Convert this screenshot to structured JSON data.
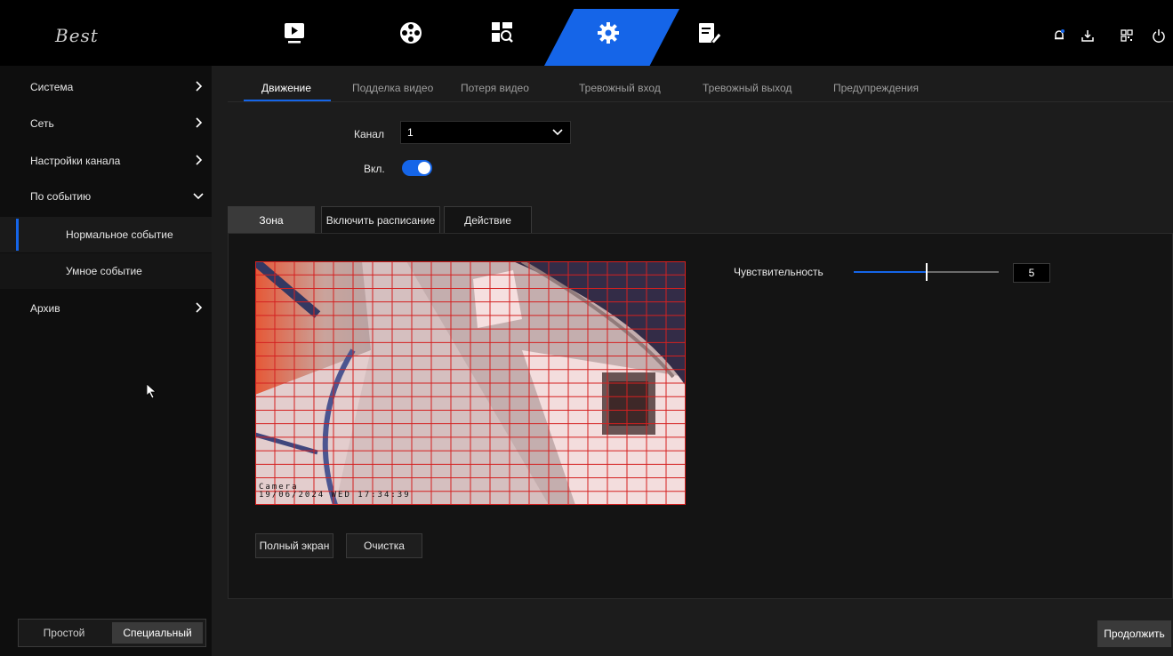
{
  "brand": {
    "logo_text": "Best",
    "accent": "#1565e8"
  },
  "topnav": {
    "items": [
      {
        "name": "playback-icon"
      },
      {
        "name": "film-reel-icon"
      },
      {
        "name": "search-files-icon"
      },
      {
        "name": "gear-icon",
        "active": true
      },
      {
        "name": "maintenance-icon"
      }
    ],
    "right_icons": [
      "bell-icon",
      "download-icon",
      "qr-code-icon",
      "power-icon"
    ]
  },
  "sidebar": {
    "items": [
      {
        "label": "Система"
      },
      {
        "label": "Сеть"
      },
      {
        "label": "Настройки канала"
      },
      {
        "label": "По событию",
        "expanded": true
      },
      {
        "label": "Нормальное событие",
        "active": true
      },
      {
        "label": "Умное событие"
      },
      {
        "label": "Архив"
      }
    ],
    "mode": {
      "simple": "Простой",
      "advanced": "Специальный",
      "selected": "advanced"
    }
  },
  "tabs": [
    "Движение",
    "Подделка видео",
    "Потеря видео",
    "Тревожный вход",
    "Тревожный выход",
    "Предупреждения"
  ],
  "form": {
    "channel_label": "Канал",
    "channel_value": "1",
    "enable_label": "Вкл.",
    "enable_on": true
  },
  "subtabs": [
    "Зона",
    "Включить расписание",
    "Действие"
  ],
  "video": {
    "osd_line1": "Camera",
    "osd_line2": "19/06/2024  WED  17:34:39",
    "grid_color": "#d42020"
  },
  "buttons": {
    "fullscreen": "Полный экран",
    "clear": "Очистка",
    "continue": "Продолжить"
  },
  "sensitivity": {
    "label": "Чувствительность",
    "value": "5",
    "fraction": 0.5
  }
}
